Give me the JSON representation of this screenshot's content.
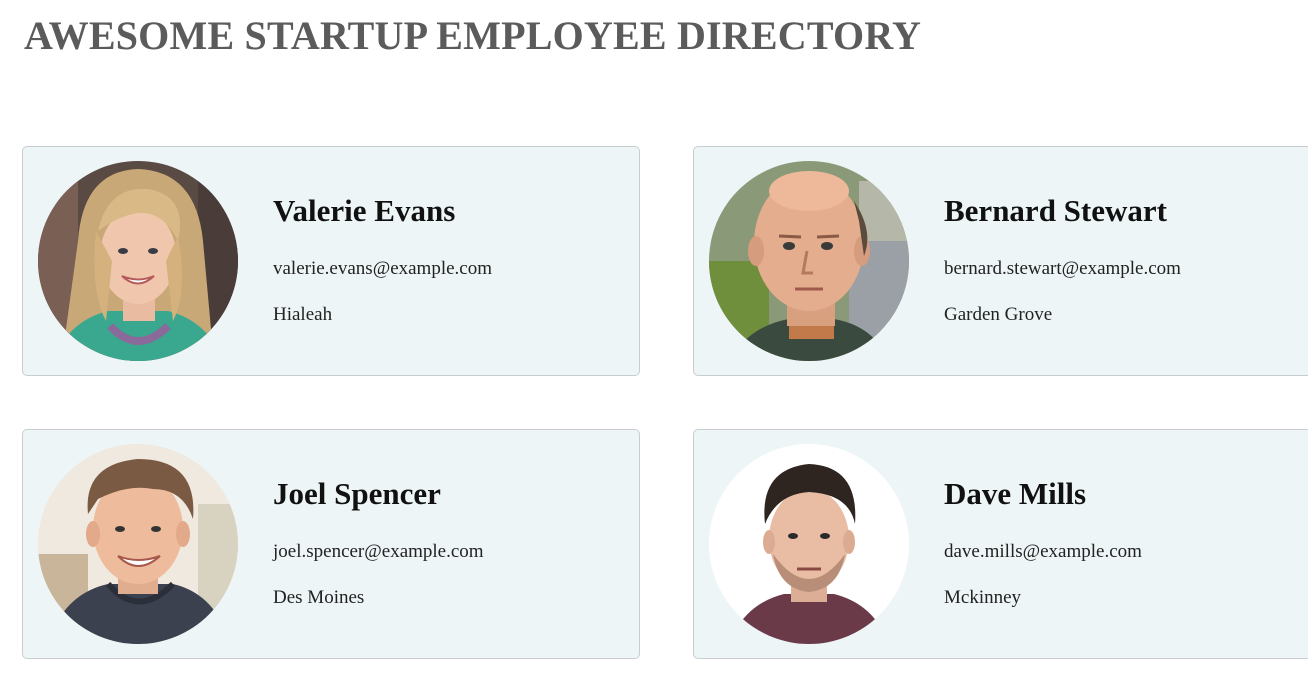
{
  "page": {
    "title": "AWESOME STARTUP EMPLOYEE DIRECTORY"
  },
  "employees": [
    {
      "name": "Valerie Evans",
      "email": "valerie.evans@example.com",
      "city": "Hialeah",
      "avatar": "woman-portrait-avatar"
    },
    {
      "name": "Bernard Stewart",
      "email": "bernard.stewart@example.com",
      "city": "Garden Grove",
      "avatar": "bald-man-portrait-avatar"
    },
    {
      "name": "Joel Spencer",
      "email": "joel.spencer@example.com",
      "city": "Des Moines",
      "avatar": "young-man-portrait-avatar"
    },
    {
      "name": "Dave Mills",
      "email": "dave.mills@example.com",
      "city": "Mckinney",
      "avatar": "dark-haired-man-portrait-avatar"
    }
  ]
}
